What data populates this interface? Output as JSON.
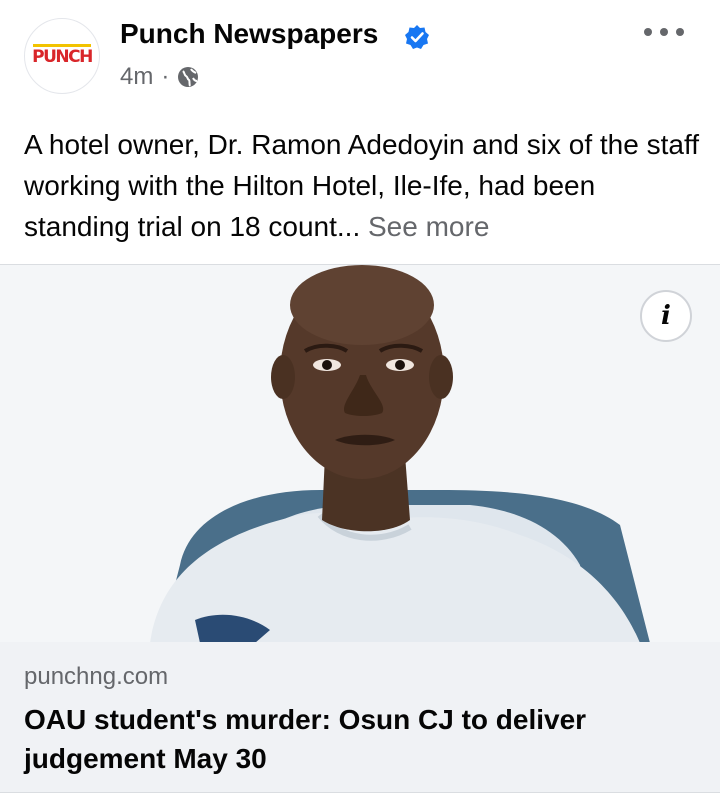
{
  "post": {
    "page_name": "Punch Newspapers",
    "avatar_logo_text": "PUNCH",
    "time": "4m",
    "separator": "·",
    "audience_icon": "globe-icon",
    "verified_icon": "verified-badge-icon",
    "more_icon": "more-options-icon",
    "caption": "A hotel owner, Dr. Ramon Adedoyin and six of the staff working with the Hilton Hotel, Ile-Ife, had been standing trial on 18 count...",
    "see_more": "See more",
    "info_button": "i"
  },
  "link_preview": {
    "domain": "punchng.com",
    "headline": "OAU student's murder: Osun CJ to deliver judgement May 30"
  },
  "colors": {
    "brand_blue": "#1877f2",
    "secondary_text": "#65676b",
    "preview_bg": "#f0f2f5",
    "punch_red": "#d9262a",
    "punch_yellow": "#f2c300"
  }
}
